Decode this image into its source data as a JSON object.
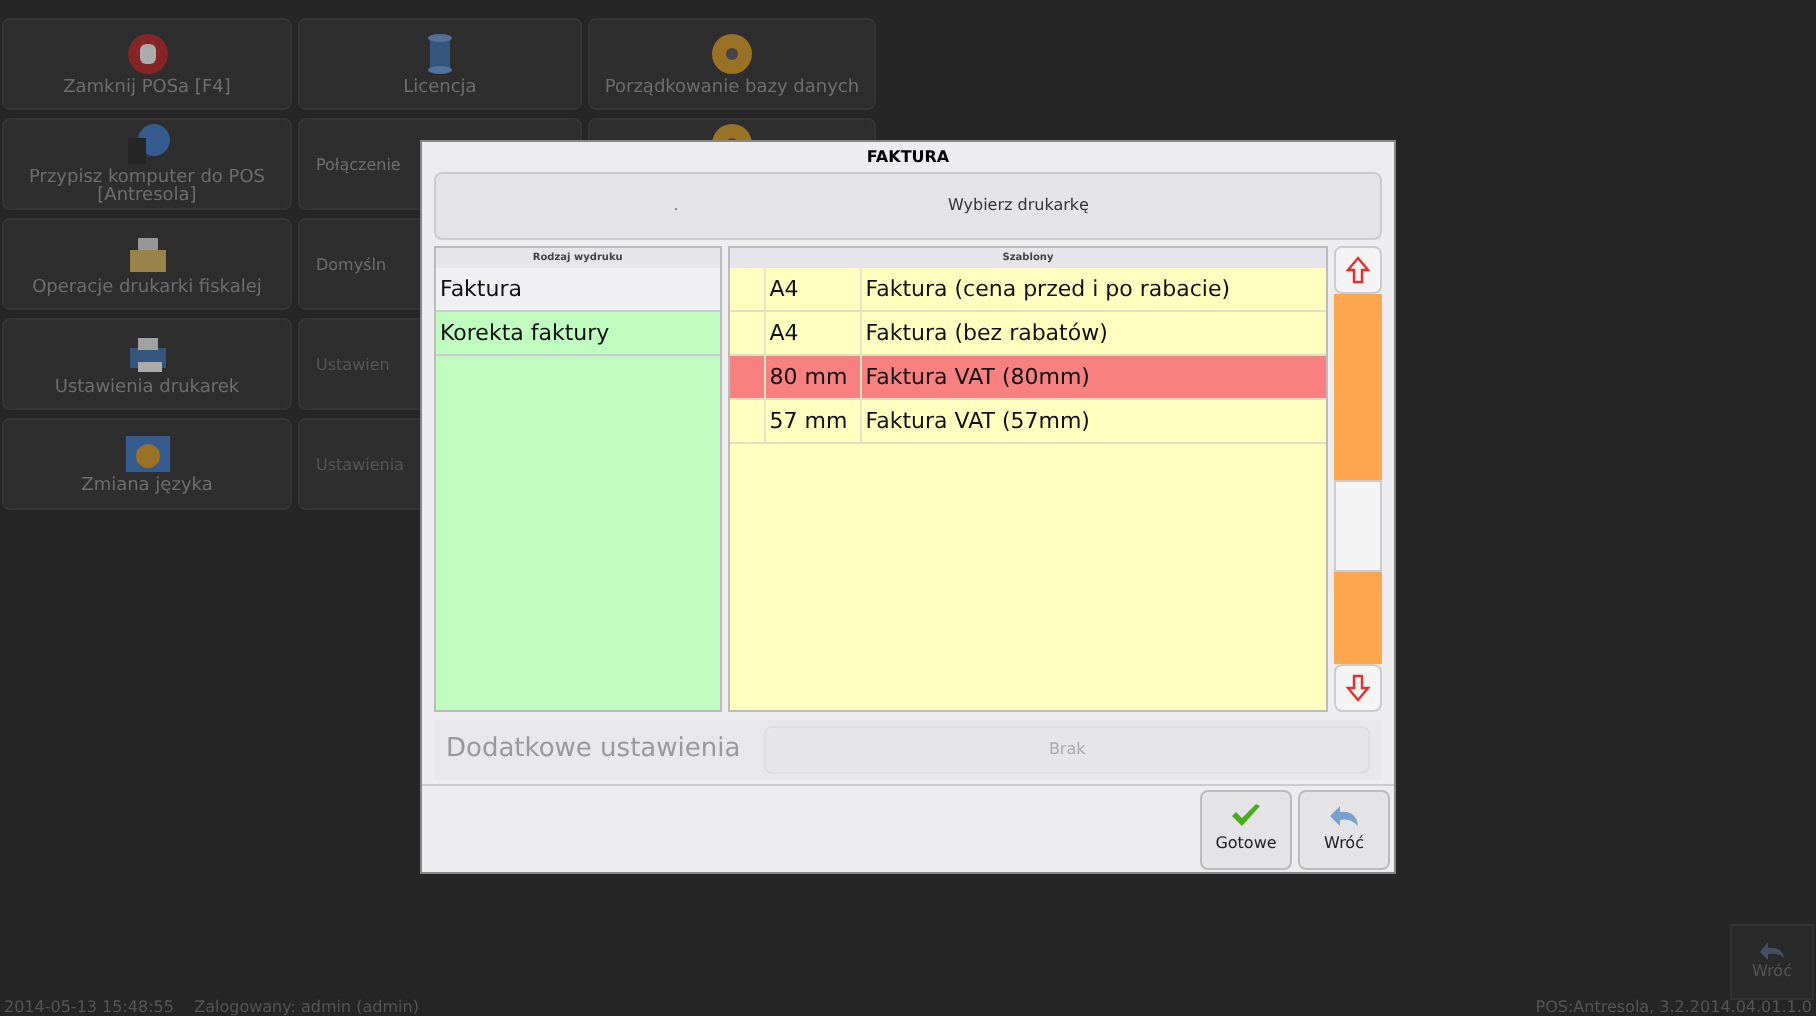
{
  "background_menu": {
    "rows": [
      [
        {
          "label": "Zamknij POSa [F4]",
          "disabled": false
        },
        {
          "label": "Licencja",
          "disabled": false
        },
        {
          "label": "Porządkowanie bazy danych",
          "disabled": false
        }
      ],
      [
        {
          "label": "Przypisz komputer do POS [Antresola]",
          "disabled": false
        },
        {
          "label": "Połączenie",
          "disabled": false
        },
        {}
      ],
      [
        {
          "label": "Operacje drukarki fiskalej",
          "disabled": false
        },
        {
          "label": "Domyśln",
          "disabled": false
        }
      ],
      [
        {
          "label": "Ustawienia drukarek",
          "disabled": false
        },
        {
          "label": "Ustawien",
          "disabled": true
        }
      ],
      [
        {
          "label": "Zmiana języka",
          "disabled": false
        },
        {
          "label": "Ustawienia",
          "disabled": true
        }
      ]
    ]
  },
  "back_tile": {
    "label": "Wróć"
  },
  "status_bar": {
    "left": "2014-05-13 15:48:55    Zalogowany: admin (admin)",
    "right": "POS:Antresola, 3.2.2014.04.01.1.0"
  },
  "dialog": {
    "title": "FAKTURA",
    "printer_button": {
      "prefix": ".",
      "label": "Wybierz drukarkę"
    },
    "print_types": {
      "header": "Rodzaj wydruku",
      "items": [
        {
          "label": "Faktura",
          "selected": true
        },
        {
          "label": "Korekta faktury",
          "selected": false
        }
      ]
    },
    "templates": {
      "header": "Szablony",
      "rows": [
        {
          "size": "A4",
          "name": "Faktura (cena przed i po rabacie)",
          "selected": false
        },
        {
          "size": "A4",
          "name": "Faktura (bez rabatów)",
          "selected": false
        },
        {
          "size": "80 mm",
          "name": "Faktura VAT (80mm)",
          "selected": true
        },
        {
          "size": "57 mm",
          "name": "Faktura VAT (57mm)",
          "selected": false
        }
      ]
    },
    "extra_settings": {
      "label": "Dodatkowe ustawienia",
      "button": "Brak",
      "disabled": true
    },
    "buttons": [
      {
        "kind": "ok",
        "label": "Gotowe"
      },
      {
        "kind": "back",
        "label": "Wróć"
      }
    ]
  }
}
